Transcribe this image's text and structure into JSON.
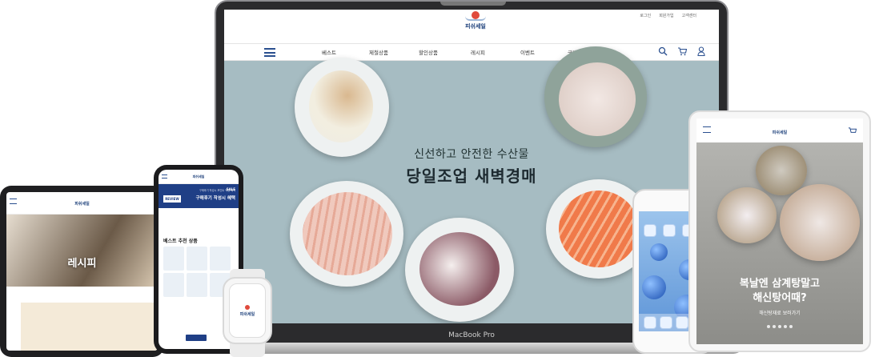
{
  "brand": {
    "logo_text": "피쉬세일"
  },
  "laptop": {
    "device_label": "MacBook Pro",
    "utility_links": [
      "로그인",
      "회원가입",
      "고객센터"
    ],
    "menu": [
      "베스트",
      "제철상품",
      "할인상품",
      "레시피",
      "이벤트",
      "구매후기"
    ],
    "icons": [
      "search-icon",
      "cart-icon",
      "user-icon"
    ],
    "hero_line1": "신선하고 안전한 수산물",
    "hero_line2": "당일조업 새벽경매"
  },
  "tablet_left": {
    "banner_label": "레시피"
  },
  "phone": {
    "banner_text": "구매후기 작성시 혜택",
    "banner_sub": "구매후기 작성시 포인트 적립 혜택",
    "review_badge": "REVIEW",
    "section_title": "베스트 추천 상품",
    "sale_badge": "SALE"
  },
  "watch": {
    "logo_text": "피쉬세일"
  },
  "tablet_right": {
    "headline_1": "복날엔 삼계탕말고",
    "headline_2": "해신탕어때?",
    "sub": "해신탕재료 보러가기"
  },
  "colors": {
    "brand_blue": "#1f3f86",
    "sun_red": "#e04a3c",
    "hero_bg": "#a6bcc2"
  }
}
